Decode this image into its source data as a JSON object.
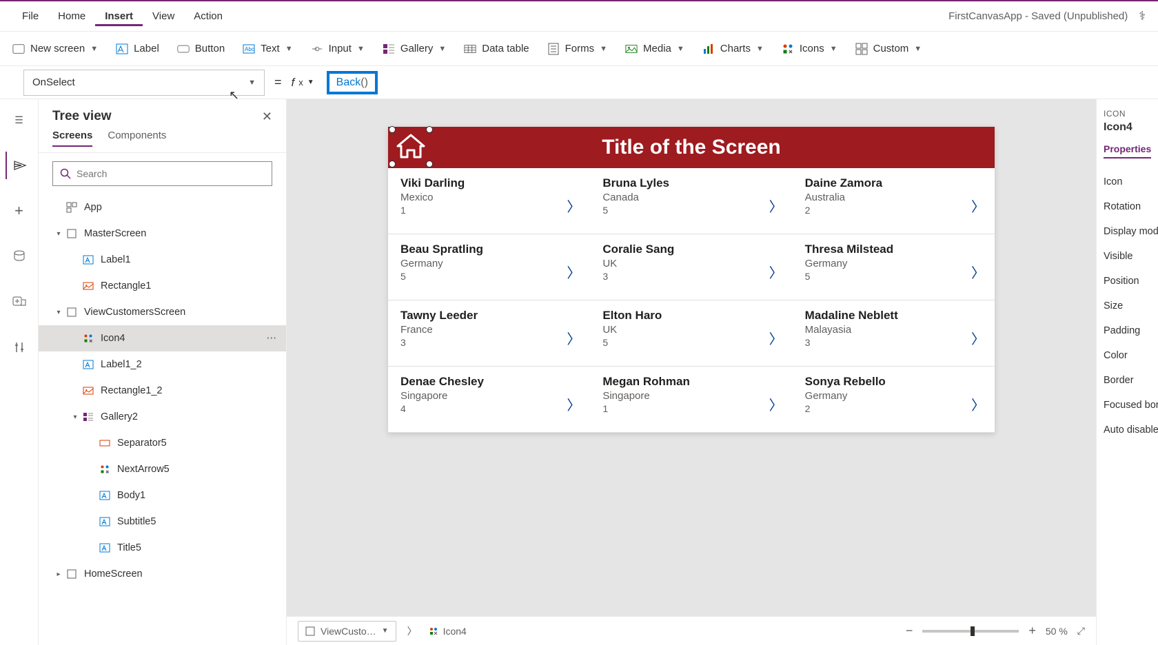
{
  "app_title": "FirstCanvasApp - Saved (Unpublished)",
  "menubar": [
    "File",
    "Home",
    "Insert",
    "View",
    "Action"
  ],
  "menubar_active": "Insert",
  "ribbon": [
    {
      "label": "New screen",
      "chev": true
    },
    {
      "label": "Label",
      "chev": false
    },
    {
      "label": "Button",
      "chev": false
    },
    {
      "label": "Text",
      "chev": true
    },
    {
      "label": "Input",
      "chev": true
    },
    {
      "label": "Gallery",
      "chev": true
    },
    {
      "label": "Data table",
      "chev": false
    },
    {
      "label": "Forms",
      "chev": true
    },
    {
      "label": "Media",
      "chev": true
    },
    {
      "label": "Charts",
      "chev": true
    },
    {
      "label": "Icons",
      "chev": true
    },
    {
      "label": "Custom",
      "chev": true
    }
  ],
  "property_dropdown": "OnSelect",
  "formula_func": "Back",
  "formula_args": "()",
  "tree": {
    "title": "Tree view",
    "tabs": [
      "Screens",
      "Components"
    ],
    "tabs_active": "Screens",
    "search_placeholder": "Search",
    "items": [
      {
        "indent": 0,
        "exp": "",
        "icon": "app",
        "label": "App"
      },
      {
        "indent": 0,
        "exp": "v",
        "icon": "screen",
        "label": "MasterScreen"
      },
      {
        "indent": 1,
        "exp": "",
        "icon": "label",
        "label": "Label1"
      },
      {
        "indent": 1,
        "exp": "",
        "icon": "rect",
        "label": "Rectangle1"
      },
      {
        "indent": 0,
        "exp": "v",
        "icon": "screen",
        "label": "ViewCustomersScreen"
      },
      {
        "indent": 1,
        "exp": "",
        "icon": "iconctl",
        "label": "Icon4",
        "selected": true
      },
      {
        "indent": 1,
        "exp": "",
        "icon": "label",
        "label": "Label1_2"
      },
      {
        "indent": 1,
        "exp": "",
        "icon": "rect",
        "label": "Rectangle1_2"
      },
      {
        "indent": 1,
        "exp": "v",
        "icon": "gallery",
        "label": "Gallery2"
      },
      {
        "indent": 2,
        "exp": "",
        "icon": "sep",
        "label": "Separator5"
      },
      {
        "indent": 2,
        "exp": "",
        "icon": "iconctl",
        "label": "NextArrow5"
      },
      {
        "indent": 2,
        "exp": "",
        "icon": "label",
        "label": "Body1"
      },
      {
        "indent": 2,
        "exp": "",
        "icon": "label",
        "label": "Subtitle5"
      },
      {
        "indent": 2,
        "exp": "",
        "icon": "label",
        "label": "Title5"
      },
      {
        "indent": 0,
        "exp": ">",
        "icon": "screen",
        "label": "HomeScreen"
      }
    ]
  },
  "screen": {
    "title": "Title of the Screen",
    "cards": [
      {
        "name": "Viki  Darling",
        "country": "Mexico",
        "num": "1"
      },
      {
        "name": "Bruna  Lyles",
        "country": "Canada",
        "num": "5"
      },
      {
        "name": "Daine  Zamora",
        "country": "Australia",
        "num": "2"
      },
      {
        "name": "Beau  Spratling",
        "country": "Germany",
        "num": "5"
      },
      {
        "name": "Coralie  Sang",
        "country": "UK",
        "num": "3"
      },
      {
        "name": "Thresa  Milstead",
        "country": "Germany",
        "num": "5"
      },
      {
        "name": "Tawny  Leeder",
        "country": "France",
        "num": "3"
      },
      {
        "name": "Elton  Haro",
        "country": "UK",
        "num": "5"
      },
      {
        "name": "Madaline  Neblett",
        "country": "Malayasia",
        "num": "3"
      },
      {
        "name": "Denae  Chesley",
        "country": "Singapore",
        "num": "4"
      },
      {
        "name": "Megan  Rohman",
        "country": "Singapore",
        "num": "1"
      },
      {
        "name": "Sonya  Rebello",
        "country": "Germany",
        "num": "2"
      }
    ]
  },
  "statusbar": {
    "crumb_screen": "ViewCusto…",
    "crumb_control": "Icon4",
    "zoom": "50 %"
  },
  "prop_panel": {
    "type_label": "ICON",
    "name": "Icon4",
    "tab": "Properties",
    "rows": [
      "Icon",
      "Rotation",
      "Display mod",
      "Visible",
      "Position",
      "Size",
      "Padding",
      "Color",
      "Border",
      "Focused bor",
      "Auto disable"
    ]
  }
}
